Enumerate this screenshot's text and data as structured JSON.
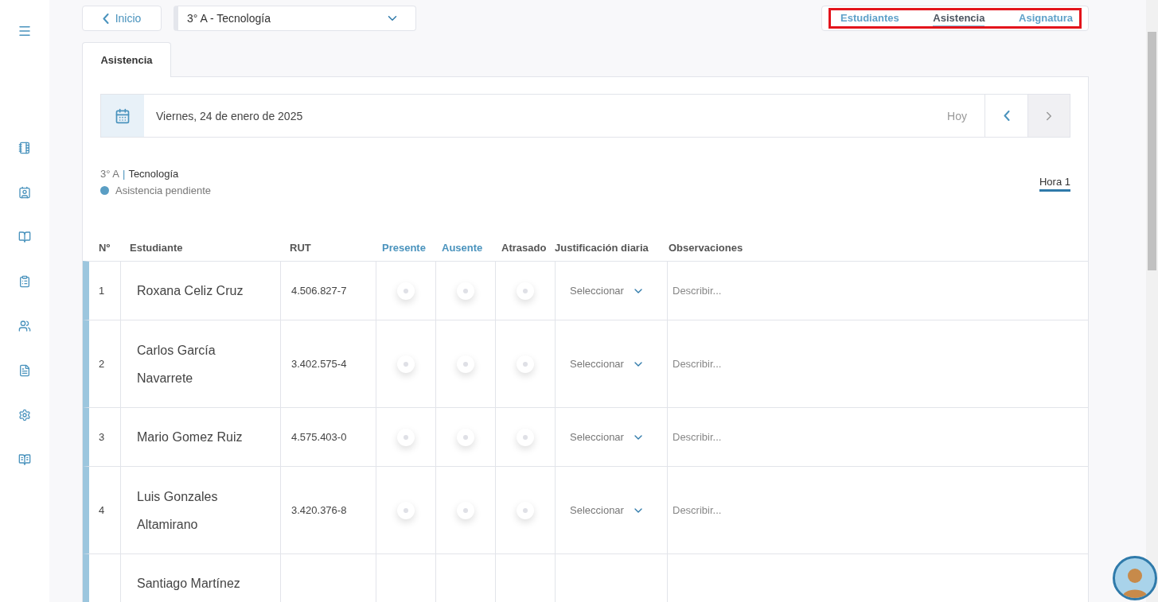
{
  "header": {
    "back_button": "Inicio",
    "course_select": {
      "value": "3° A - Tecnología"
    },
    "nav_tabs": [
      {
        "label": "Estudiantes",
        "selected": false
      },
      {
        "label": "Asistencia",
        "selected": true
      },
      {
        "label": "Asignatura",
        "selected": false
      }
    ]
  },
  "tabs": [
    {
      "label": "Asistencia",
      "selected": true
    }
  ],
  "date_bar": {
    "date": "Viernes, 24 de enero de 2025",
    "today_button": "Hoy"
  },
  "class_info": {
    "course": "3° A",
    "separator": "|",
    "subject": "Tecnología",
    "status": "Asistencia pendiente",
    "hour_tab": {
      "label": "Hora 1",
      "selected": true
    }
  },
  "table": {
    "columns": [
      {
        "label": "Nº",
        "kind": "plain"
      },
      {
        "label": "Estudiante",
        "kind": "plain"
      },
      {
        "label": "RUT",
        "kind": "plain"
      },
      {
        "label": "Presente",
        "kind": "accent"
      },
      {
        "label": "Ausente",
        "kind": "accent"
      },
      {
        "label": "Atrasado",
        "kind": "plain"
      },
      {
        "label": "Justificación diaria",
        "kind": "plain"
      },
      {
        "label": "Observaciones",
        "kind": "plain"
      }
    ],
    "rows": [
      {
        "number": "1",
        "name": "Roxana Celiz Cruz",
        "rut": "4.506.827-7",
        "present": false,
        "absent": false,
        "late": false,
        "justification": "Seleccionar",
        "observation_placeholder": "Describir..."
      },
      {
        "number": "2",
        "name": "Carlos García Navarrete",
        "rut": "3.402.575-4",
        "present": false,
        "absent": false,
        "late": false,
        "justification": "Seleccionar",
        "observation_placeholder": "Describir..."
      },
      {
        "number": "3",
        "name": "Mario Gomez Ruiz",
        "rut": "4.575.403-0",
        "present": false,
        "absent": false,
        "late": false,
        "justification": "Seleccionar",
        "observation_placeholder": "Describir..."
      },
      {
        "number": "4",
        "name": "Luis Gonzales Altamirano",
        "rut": "3.420.376-8",
        "present": false,
        "absent": false,
        "late": false,
        "justification": "Seleccionar",
        "observation_placeholder": "Describir..."
      },
      {
        "name": "Santiago Martínez"
      }
    ]
  }
}
